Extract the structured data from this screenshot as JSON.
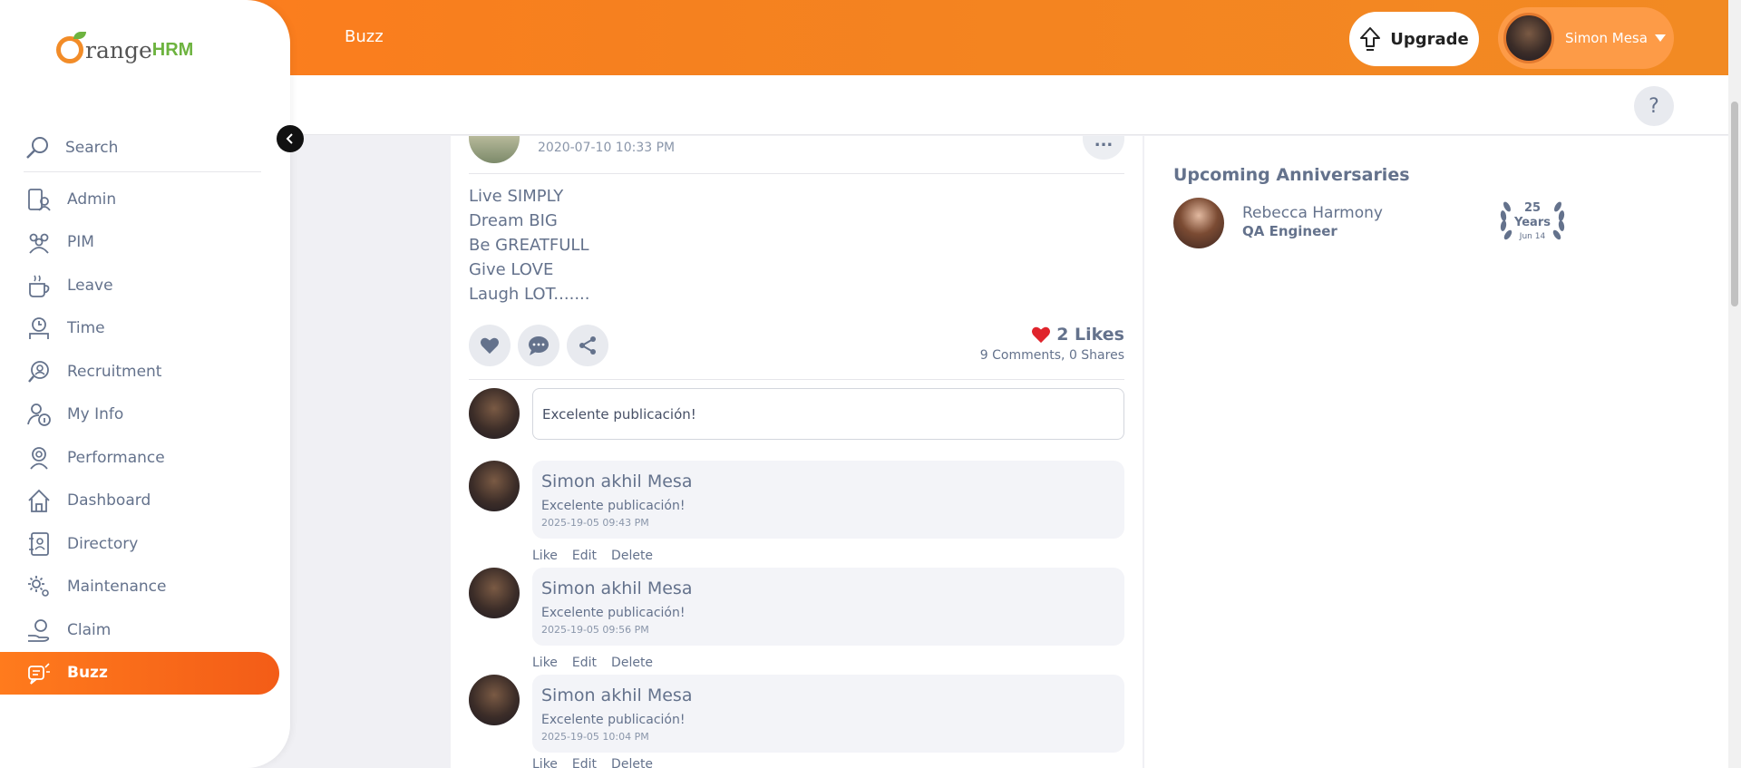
{
  "header": {
    "title": "Buzz",
    "upgrade_label": "Upgrade",
    "user_name": "Simon Mesa",
    "help_label": "?"
  },
  "colors": {
    "brand_orange": "#ff7b1d",
    "active_nav": "#f35c17",
    "text": "#64728c",
    "like_red": "#e0242c"
  },
  "logo": {
    "text_orange": "range",
    "text_hrm": "HRM"
  },
  "sidebar": {
    "search_label": "Search",
    "items": [
      {
        "label": "Admin",
        "icon": "admin-icon"
      },
      {
        "label": "PIM",
        "icon": "pim-icon"
      },
      {
        "label": "Leave",
        "icon": "leave-icon"
      },
      {
        "label": "Time",
        "icon": "time-icon"
      },
      {
        "label": "Recruitment",
        "icon": "recruitment-icon"
      },
      {
        "label": "My Info",
        "icon": "my-info-icon"
      },
      {
        "label": "Performance",
        "icon": "performance-icon"
      },
      {
        "label": "Dashboard",
        "icon": "dashboard-icon"
      },
      {
        "label": "Directory",
        "icon": "directory-icon"
      },
      {
        "label": "Maintenance",
        "icon": "maintenance-icon"
      },
      {
        "label": "Claim",
        "icon": "claim-icon"
      },
      {
        "label": "Buzz",
        "icon": "buzz-icon",
        "active": true
      }
    ]
  },
  "post": {
    "date": "2020-07-10 10:33 PM",
    "menu_label": "...",
    "lines": [
      "Live SIMPLY",
      "Dream BIG",
      "Be GREATFULL",
      "Give LOVE",
      "Laugh LOT......."
    ],
    "likes": "2 Likes",
    "comments_count": "9 Comments,",
    "shares_count": "0 Shares",
    "new_comment_value": "Excelente publicación!"
  },
  "comments": [
    {
      "author": "Simon akhil Mesa",
      "text": "Excelente publicación!",
      "time": "2025-19-05 09:43 PM"
    },
    {
      "author": "Simon akhil Mesa",
      "text": "Excelente publicación!",
      "time": "2025-19-05 09:56 PM"
    },
    {
      "author": "Simon akhil Mesa",
      "text": "Excelente publicación!",
      "time": "2025-19-05 10:04 PM"
    }
  ],
  "comment_actions": {
    "like": "Like",
    "edit": "Edit",
    "delete": "Delete"
  },
  "anniversaries": {
    "title": "Upcoming Anniversaries",
    "name": "Rebecca Harmony",
    "role": "QA Engineer",
    "years_number": "25",
    "years_label": "Years",
    "date": "Jun 14"
  }
}
